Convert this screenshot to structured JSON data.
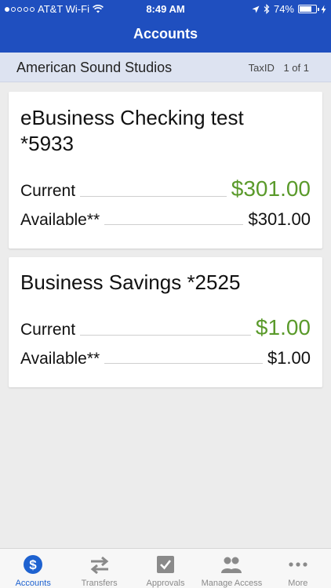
{
  "status_bar": {
    "carrier": "AT&T Wi-Fi",
    "time": "8:49 AM",
    "battery": "74%"
  },
  "nav": {
    "title": "Accounts"
  },
  "company": {
    "name": "American Sound Studios",
    "taxid_label": "TaxID",
    "page": "1 of 1"
  },
  "accounts": [
    {
      "title_line1": "eBusiness Checking test",
      "title_line2": "*5933",
      "current_label": "Current",
      "current": "$301.00",
      "available_label": "Available**",
      "available": "$301.00"
    },
    {
      "title_line1": "Business Savings *2525",
      "current_label": "Current",
      "current": "$1.00",
      "available_label": "Available**",
      "available": "$1.00"
    }
  ],
  "tabs": [
    {
      "label": "Accounts",
      "icon": "dollar-circle-icon",
      "active": true
    },
    {
      "label": "Transfers",
      "icon": "transfer-arrows-icon",
      "active": false
    },
    {
      "label": "Approvals",
      "icon": "checkbox-icon",
      "active": false
    },
    {
      "label": "Manage Access",
      "icon": "people-icon",
      "active": false
    },
    {
      "label": "More",
      "icon": "more-dots-icon",
      "active": false
    }
  ],
  "colors": {
    "header": "#1f4fbf",
    "current_amount": "#5a9a2b",
    "active_tab": "#1e62d0",
    "inactive_tab": "#8a8a8a"
  }
}
